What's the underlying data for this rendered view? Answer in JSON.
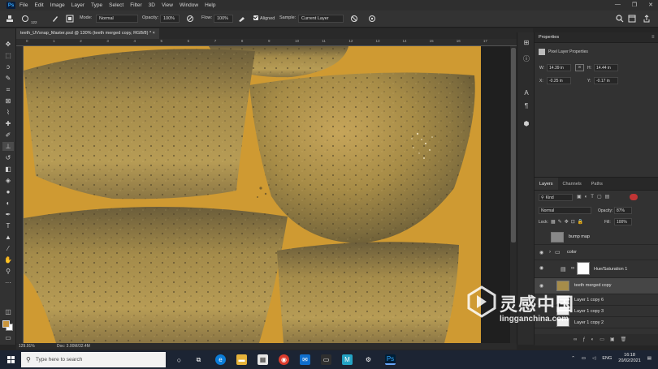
{
  "app": {
    "logo": "Ps",
    "menu": [
      "File",
      "Edit",
      "Image",
      "Layer",
      "Type",
      "Select",
      "Filter",
      "3D",
      "View",
      "Window",
      "Help"
    ],
    "window_controls": [
      "—",
      "❐",
      "✕"
    ]
  },
  "options_bar": {
    "brush_size": "122",
    "mode_label": "Mode:",
    "mode_value": "Normal",
    "opacity_label": "Opacity:",
    "opacity_value": "100%",
    "flow_label": "Flow:",
    "flow_value": "100%",
    "aligned_label": "Aligned",
    "sample_label": "Sample:",
    "sample_value": "Current Layer"
  },
  "document": {
    "tab_title": "teeth_UVsnap_Master.psd @ 130% (teeth merged copy, RGB/8) * ×"
  },
  "ruler_top_ticks": [
    "0",
    "1",
    "2",
    "3",
    "4",
    "5",
    "6",
    "7",
    "8",
    "9",
    "10",
    "11",
    "12",
    "13",
    "14",
    "15",
    "16",
    "17"
  ],
  "status": {
    "zoom": "129.91%",
    "doc": "Doc: 3.00M/32.4M"
  },
  "properties": {
    "title": "Properties",
    "subtitle": "Pixel Layer Properties",
    "w_label": "W:",
    "w_value": "14.39 in",
    "h_label": "H:",
    "h_value": "14.44 in",
    "x_label": "X:",
    "x_value": "-0.25 in",
    "y_label": "Y:",
    "y_value": "-0.17 in"
  },
  "layers": {
    "tabs": [
      "Layers",
      "Channels",
      "Paths"
    ],
    "kind_label": "Kind",
    "blend_mode": "Normal",
    "opacity_label": "Opacity:",
    "opacity_value": "87%",
    "lock_label": "Lock:",
    "fill_label": "Fill:",
    "fill_value": "100%",
    "items": [
      {
        "name": "bump map"
      },
      {
        "name": "color"
      },
      {
        "name": "Hue/Saturation 1"
      },
      {
        "name": "teeth merged copy"
      },
      {
        "name": "Layer 1 copy 6"
      },
      {
        "name": "Layer 1 copy 3"
      },
      {
        "name": "Layer 1 copy 2"
      }
    ]
  },
  "taskbar": {
    "search_placeholder": "Type here to search",
    "language": "ENG",
    "time": "16:18",
    "date": "20/02/2021"
  },
  "watermark": {
    "chinese": "灵感中国",
    "domain": "lingganchina.com"
  }
}
